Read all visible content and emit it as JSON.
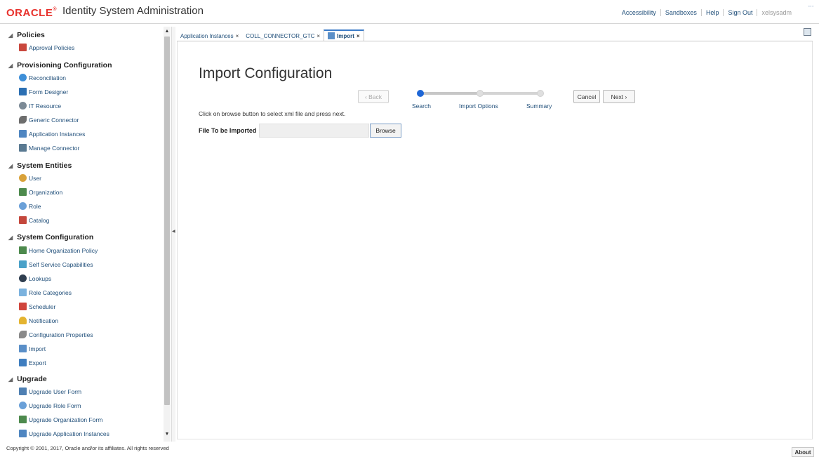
{
  "header": {
    "logo": "ORACLE",
    "app_title": "Identity System Administration",
    "links": [
      "Accessibility",
      "Sandboxes",
      "Help",
      "Sign Out"
    ],
    "user": "xelsysadm"
  },
  "sidebar": {
    "sections": [
      {
        "title": "Policies",
        "items": [
          "Approval Policies"
        ]
      },
      {
        "title": "Provisioning Configuration",
        "items": [
          "Reconciliation",
          "Form Designer",
          "IT Resource",
          "Generic Connector",
          "Application Instances",
          "Manage Connector"
        ]
      },
      {
        "title": "System Entities",
        "items": [
          "User",
          "Organization",
          "Role",
          "Catalog"
        ]
      },
      {
        "title": "System Configuration",
        "items": [
          "Home Organization Policy",
          "Self Service Capabilities",
          "Lookups",
          "Role Categories",
          "Scheduler",
          "Notification",
          "Configuration Properties",
          "Import",
          "Export"
        ]
      },
      {
        "title": "Upgrade",
        "items": [
          "Upgrade User Form",
          "Upgrade Role Form",
          "Upgrade Organization Form",
          "Upgrade Application Instances"
        ]
      }
    ]
  },
  "tabs": [
    {
      "label": "Application Instances",
      "active": false
    },
    {
      "label": "COLL_CONNECTOR_GTC",
      "active": false
    },
    {
      "label": "Import",
      "active": true
    }
  ],
  "main": {
    "title": "Import Configuration",
    "back_label": "Back",
    "cancel_label": "Cancel",
    "next_label": "Next",
    "train_stops": [
      "Search",
      "Import Options",
      "Summary"
    ],
    "instruction": "Click on browse button to select xml file and press next.",
    "file_label": "File To be Imported",
    "file_value": "",
    "browse_label": "Browse"
  },
  "footer": {
    "copyright": "Copyright © 2001, 2017, Oracle and/or its affiliates. All rights reserved",
    "about_label": "About"
  },
  "colors": {
    "oracle_red": "#e8322d",
    "link_blue": "#1f4e79",
    "train_current": "#1e66d6",
    "tab_accent": "#3a7bc8"
  }
}
